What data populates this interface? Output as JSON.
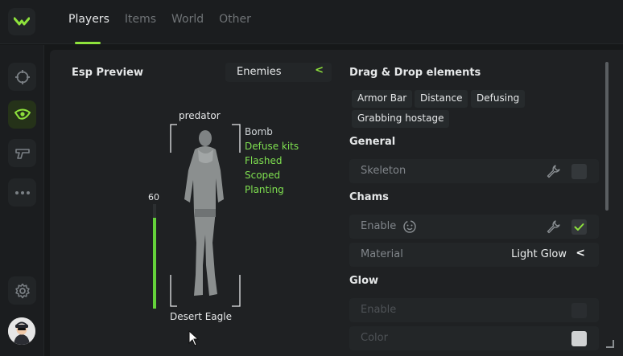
{
  "app": {
    "accent": "#8ee23c",
    "health_color": "#64d23a"
  },
  "tabs": [
    {
      "label": "Players",
      "active": true
    },
    {
      "label": "Items",
      "active": false
    },
    {
      "label": "World",
      "active": false
    },
    {
      "label": "Other",
      "active": false
    }
  ],
  "sidebar": {
    "items": [
      {
        "icon": "crosshair-icon",
        "active": false
      },
      {
        "icon": "eye-icon",
        "active": true
      },
      {
        "icon": "pistol-icon",
        "active": false
      },
      {
        "icon": "more-icon",
        "active": false
      }
    ],
    "settings_icon": "gear-icon",
    "avatar_icon": "user-avatar-icon"
  },
  "preview": {
    "title": "Esp Preview",
    "target_select": "Enemies",
    "player_name": "predator",
    "health": "60",
    "health_level": 0.6,
    "weapon": "Desert Eagle",
    "flags": [
      {
        "label": "Bomb",
        "color": "#cfd3d6"
      },
      {
        "label": "Defuse kits",
        "color": "#7fe050"
      },
      {
        "label": "Flashed",
        "color": "#7fe050"
      },
      {
        "label": "Scoped",
        "color": "#7fe050"
      },
      {
        "label": "Planting",
        "color": "#7fe050"
      }
    ]
  },
  "drag_drop": {
    "title": "Drag & Drop elements",
    "chips": [
      "Armor Bar",
      "Distance",
      "Defusing",
      "Grabbing hostage"
    ]
  },
  "general": {
    "title": "General",
    "skeleton_label": "Skeleton",
    "skeleton_checked": false
  },
  "chams": {
    "title": "Chams",
    "enable_label": "Enable",
    "enable_checked": true,
    "material_label": "Material",
    "material_value": "Light Glow"
  },
  "glow": {
    "title": "Glow",
    "enable_label": "Enable",
    "color_label": "Color"
  }
}
